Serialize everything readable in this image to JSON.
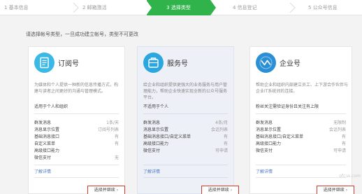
{
  "steps": [
    {
      "label": "1 基本信息"
    },
    {
      "label": "2 邮箱激活"
    },
    {
      "label": "3 选择类型"
    },
    {
      "label": "4 信息登记"
    },
    {
      "label": "5 公众号信息"
    }
  ],
  "instruction": "请选择帐号类型，一旦成功建立帐号，类型不可更改",
  "cards": [
    {
      "icon": "subscription-icon",
      "icon_color": "#3bb9e6",
      "title": "订阅号",
      "desc": "为媒体和个人提供一种新的信息传播方式，构建与读者之间更好的沟通与管理模式。",
      "audience": "适用于个人和组织",
      "features": [
        {
          "name": "群发消息",
          "value": "1条/天"
        },
        {
          "name": "消息显示位置",
          "value": "订阅号列表"
        },
        {
          "name": "基础消息接口",
          "value": "有"
        },
        {
          "name": "自定义菜单",
          "value": "有"
        },
        {
          "name": "高级接口能力",
          "value": ""
        },
        {
          "name": "微信支付",
          "value": "无"
        }
      ],
      "learn_more": "了解详情",
      "choose": "选择并继续"
    },
    {
      "icon": "service-icon",
      "icon_color": "#2aa6e0",
      "title": "服务号",
      "desc": "给企业和组织提供更强大的业务服务与用户管理能力，帮助企业快速实现全新的公众号服务平台。",
      "audience": "不适用于个人",
      "features": [
        {
          "name": "群发消息",
          "value": "4条/月"
        },
        {
          "name": "消息显示位置",
          "value": "会话列表"
        },
        {
          "name": "基础消息接口/自定义菜单",
          "value": "有"
        },
        {
          "name": "高级接口能力",
          "value": "有"
        },
        {
          "name": "微信支付",
          "value": "可申请"
        }
      ],
      "learn_more": "了解详情",
      "choose": "选择并继续"
    },
    {
      "icon": "enterprise-icon",
      "icon_color": "#2b8fd6",
      "title": "企业号",
      "desc": "帮助企业和组织内部建立员工、上下游合作伙伴与企业IT系统间的连接。",
      "audience": "粉丝关注需验证身份且关注有上限",
      "features": [
        {
          "name": "群发消息",
          "value": "无限制"
        },
        {
          "name": "消息显示位置",
          "value": "会话列表"
        },
        {
          "name": "基础消息接口/自定义菜单",
          "value": "有"
        },
        {
          "name": "高级接口能力",
          "value": "有"
        },
        {
          "name": "微信支付",
          "value": "可申请"
        }
      ],
      "learn_more": "了解详情",
      "choose": "选择并继续"
    }
  ],
  "watermark": "ofcus.com",
  "colors": {
    "active_step": "#2fb34a",
    "button_border": "#d23b2c",
    "link": "#4a78c2"
  }
}
